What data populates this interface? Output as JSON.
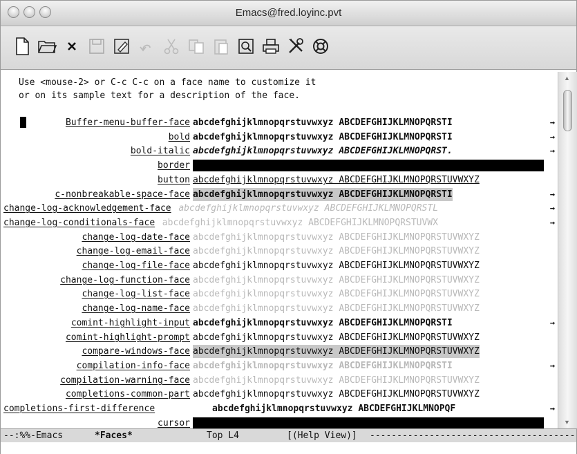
{
  "window": {
    "title": "Emacs@fred.loyinc.pvt"
  },
  "toolbar": {
    "items": [
      "new-file",
      "open-folder",
      "close",
      "save",
      "save-as",
      "undo",
      "cut",
      "copy",
      "paste",
      "search",
      "print",
      "preferences",
      "help"
    ]
  },
  "intro": {
    "line1": "Use <mouse-2> or C-c C-c on a face name to customize it",
    "line2": "or on its sample text for a description of the face."
  },
  "sample_text": "abcdefghijklmnopqrstuvwxyz ABCDEFGHIJKLMNOPQRSTUVWXYZ",
  "faces": [
    {
      "name": "Buffer-menu-buffer-face",
      "sample": "abcdefghijklmnopqrstuvwxyz ABCDEFGHIJKLMNOPQRSTI",
      "style": "bold",
      "truncated": true
    },
    {
      "name": "bold",
      "sample": "abcdefghijklmnopqrstuvwxyz ABCDEFGHIJKLMNOPQRSTI",
      "style": "bold",
      "truncated": true
    },
    {
      "name": "bold-italic",
      "sample": "abcdefghijklmnopqrstuvwxyz ABCDEFGHIJKLMNOPQRST.",
      "style": "bold-italic",
      "truncated": true
    },
    {
      "name": "border",
      "sample": "",
      "style": "black-bar",
      "truncated": false
    },
    {
      "name": "button",
      "sample": "abcdefghijklmnopqrstuvwxyz ABCDEFGHIJKLMNOPQRSTUVWXYZ",
      "style": "underline",
      "truncated": false
    },
    {
      "name": "c-nonbreakable-space-face",
      "sample": "abcdefghijklmnopqrstuvwxyz ABCDEFGHIJKLMNOPQRSTI",
      "style": "bold-gray",
      "truncated": true
    },
    {
      "name": "change-log-acknowledgement-face",
      "sample": "abcdefghijklmnopqrstuvwxyz ABCDEFGHIJKLMNOPQRSTL",
      "style": "faint-italic",
      "truncated": true
    },
    {
      "name": "change-log-conditionals-face",
      "sample": "abcdefghijklmnopqrstuvwxyz ABCDEFGHIJKLMNOPQRSTUVWX",
      "style": "faint",
      "truncated": true
    },
    {
      "name": "change-log-date-face",
      "sample": "abcdefghijklmnopqrstuvwxyz ABCDEFGHIJKLMNOPQRSTUVWXYZ",
      "style": "faint",
      "truncated": false
    },
    {
      "name": "change-log-email-face",
      "sample": "abcdefghijklmnopqrstuvwxyz ABCDEFGHIJKLMNOPQRSTUVWXYZ",
      "style": "faint",
      "truncated": false
    },
    {
      "name": "change-log-file-face",
      "sample": "abcdefghijklmnopqrstuvwxyz ABCDEFGHIJKLMNOPQRSTUVWXYZ",
      "style": "normal",
      "truncated": false
    },
    {
      "name": "change-log-function-face",
      "sample": "abcdefghijklmnopqrstuvwxyz ABCDEFGHIJKLMNOPQRSTUVWXYZ",
      "style": "faint",
      "truncated": false
    },
    {
      "name": "change-log-list-face",
      "sample": "abcdefghijklmnopqrstuvwxyz ABCDEFGHIJKLMNOPQRSTUVWXYZ",
      "style": "faint",
      "truncated": false
    },
    {
      "name": "change-log-name-face",
      "sample": "abcdefghijklmnopqrstuvwxyz ABCDEFGHIJKLMNOPQRSTUVWXYZ",
      "style": "faint",
      "truncated": false
    },
    {
      "name": "comint-highlight-input",
      "sample": "abcdefghijklmnopqrstuvwxyz ABCDEFGHIJKLMNOPQRSTI",
      "style": "bold",
      "truncated": true
    },
    {
      "name": "comint-highlight-prompt",
      "sample": "abcdefghijklmnopqrstuvwxyz ABCDEFGHIJKLMNOPQRSTUVWXYZ",
      "style": "normal",
      "truncated": false
    },
    {
      "name": "compare-windows-face",
      "sample": "abcdefghijklmnopqrstuvwxyz ABCDEFGHIJKLMNOPQRSTUVWXYZ",
      "style": "gray-bg",
      "truncated": false
    },
    {
      "name": "compilation-info-face",
      "sample": "abcdefghijklmnopqrstuvwxyz ABCDEFGHIJKLMNOPQRSTI",
      "style": "faint-bold",
      "truncated": true
    },
    {
      "name": "compilation-warning-face",
      "sample": "abcdefghijklmnopqrstuvwxyz ABCDEFGHIJKLMNOPQRSTUVWXYZ",
      "style": "faint",
      "truncated": false
    },
    {
      "name": "completions-common-part",
      "sample": "abcdefghijklmnopqrstuvwxyz ABCDEFGHIJKLMNOPQRSTUVWXYZ",
      "style": "normal",
      "truncated": false
    },
    {
      "name": "completions-first-difference",
      "sample": "abcdefghijklmnopqrstuvwxyz ABCDEFGHIJKLMNOPQF",
      "style": "bold-wide",
      "truncated": true
    },
    {
      "name": "cursor",
      "sample": "",
      "style": "black-bar",
      "truncated": false
    }
  ],
  "truncation_arrow": "→",
  "modeline": {
    "status": "--:%%-Emacs",
    "buffer": "*Faces*",
    "position": "Top L4",
    "modes": "[(Help View)]",
    "fill": "------------------------------------------"
  }
}
